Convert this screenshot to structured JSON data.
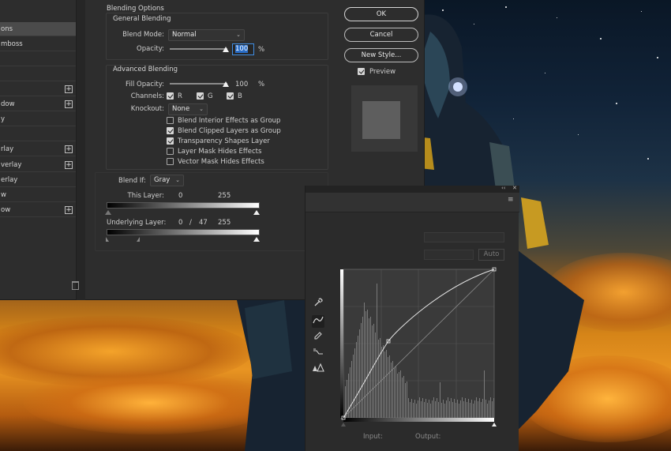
{
  "layer_styles": {
    "items": [
      {
        "label": "ons",
        "active": true,
        "has_plus": false
      },
      {
        "label": "mboss",
        "active": false,
        "has_plus": false
      },
      {
        "label": "",
        "active": false,
        "has_plus": false
      },
      {
        "label": "",
        "active": false,
        "has_plus": false
      },
      {
        "label": "",
        "active": false,
        "has_plus": true
      },
      {
        "label": "dow",
        "active": false,
        "has_plus": true
      },
      {
        "label": "y",
        "active": false,
        "has_plus": false
      },
      {
        "label": "",
        "active": false,
        "has_plus": false
      },
      {
        "label": "rlay",
        "active": false,
        "has_plus": true
      },
      {
        "label": "verlay",
        "active": false,
        "has_plus": true
      },
      {
        "label": "erlay",
        "active": false,
        "has_plus": false
      },
      {
        "label": "w",
        "active": false,
        "has_plus": false
      },
      {
        "label": "ow",
        "active": false,
        "has_plus": true
      }
    ],
    "plus_glyph": "+"
  },
  "blending": {
    "section_title": "Blending Options",
    "general": {
      "title": "General Blending",
      "blend_mode_label": "Blend Mode:",
      "blend_mode_value": "Normal",
      "opacity_label": "Opacity:",
      "opacity_value": "100",
      "opacity_level_pct": 100,
      "percent": "%"
    },
    "advanced": {
      "title": "Advanced Blending",
      "fill_opacity_label": "Fill Opacity:",
      "fill_opacity_value": "100",
      "fill_opacity_level_pct": 100,
      "percent": "%",
      "channels_label": "Channels:",
      "channel_r": "R",
      "channel_g": "G",
      "channel_b": "B",
      "knockout_label": "Knockout:",
      "knockout_value": "None",
      "options": [
        {
          "label": "Blend Interior Effects as Group",
          "checked": false
        },
        {
          "label": "Blend Clipped Layers as Group",
          "checked": true
        },
        {
          "label": "Transparency Shapes Layer",
          "checked": true
        },
        {
          "label": "Layer Mask Hides Effects",
          "checked": false
        },
        {
          "label": "Vector Mask Hides Effects",
          "checked": false
        }
      ]
    },
    "blend_if": {
      "label": "Blend If:",
      "value": "Gray",
      "this_layer_label": "This Layer:",
      "this_layer_low": "0",
      "this_layer_high": "255",
      "underlying_label": "Underlying Layer:",
      "underlying_low": "0",
      "underlying_sep": "/",
      "underlying_split": "47",
      "underlying_high": "255"
    }
  },
  "buttons": {
    "ok": "OK",
    "cancel": "Cancel",
    "new_style": "New Style...",
    "preview_label": "Preview",
    "preview_checked": true
  },
  "curves": {
    "collapse_glyph": "‹‹",
    "close_glyph": "✕",
    "menu_glyph": "≡",
    "auto_label": "Auto",
    "input_label": "Input:",
    "output_label": "Output:",
    "tools": [
      "eyedropper-icon",
      "curve-point-icon",
      "pencil-icon",
      "smooth-icon",
      "clipping-warning-icon"
    ]
  },
  "colors": {
    "dialog_bg": "#2d2d2d",
    "accent_focus": "#3f8de3",
    "sunset_orange": "#e89422"
  }
}
